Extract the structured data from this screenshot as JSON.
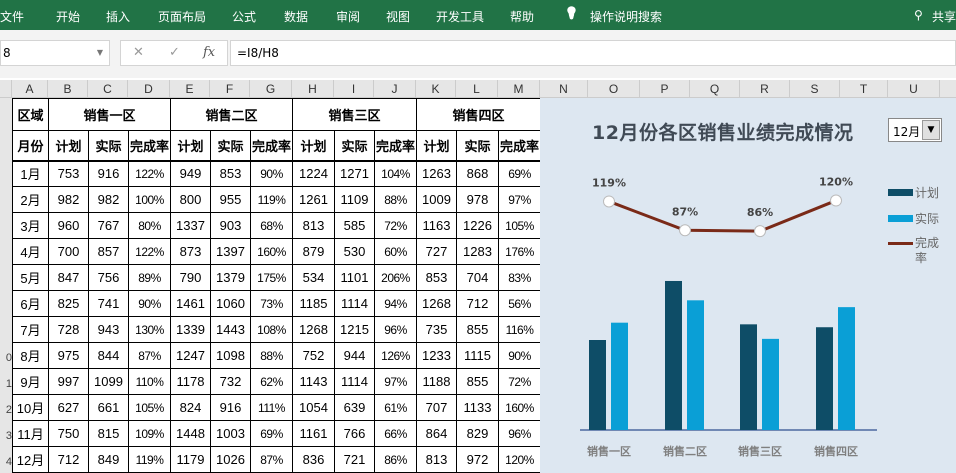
{
  "ribbon": {
    "tabs": [
      "文件",
      "开始",
      "插入",
      "页面布局",
      "公式",
      "数据",
      "审阅",
      "视图",
      "开发工具",
      "帮助"
    ],
    "search": "操作说明搜索",
    "share": "共享"
  },
  "formula_bar": {
    "name_box": "8",
    "cancel": "✕",
    "enter": "✓",
    "fx": "fx",
    "formula": "=I8/H8"
  },
  "columns": [
    "A",
    "B",
    "C",
    "D",
    "E",
    "F",
    "G",
    "H",
    "I",
    "J",
    "K",
    "L",
    "M",
    "N",
    "O",
    "P",
    "Q",
    "R",
    "S",
    "T",
    "U"
  ],
  "row_numbers": [
    "",
    "",
    "",
    "",
    "",
    "",
    "",
    "",
    "",
    "0",
    "1",
    "2",
    "3",
    "4"
  ],
  "table": {
    "region_label": "区域",
    "month_label": "月份",
    "regions": [
      "销售一区",
      "销售二区",
      "销售三区",
      "销售四区"
    ],
    "sub_headers": [
      "计划",
      "实际",
      "完成率"
    ],
    "rows": [
      [
        "1月",
        "753",
        "916",
        "122%",
        "949",
        "853",
        "90%",
        "1224",
        "1271",
        "104%",
        "1263",
        "868",
        "69%"
      ],
      [
        "2月",
        "982",
        "982",
        "100%",
        "800",
        "955",
        "119%",
        "1261",
        "1109",
        "88%",
        "1009",
        "978",
        "97%"
      ],
      [
        "3月",
        "960",
        "767",
        "80%",
        "1337",
        "903",
        "68%",
        "813",
        "585",
        "72%",
        "1163",
        "1226",
        "105%"
      ],
      [
        "4月",
        "700",
        "857",
        "122%",
        "873",
        "1397",
        "160%",
        "879",
        "530",
        "60%",
        "727",
        "1283",
        "176%"
      ],
      [
        "5月",
        "847",
        "756",
        "89%",
        "790",
        "1379",
        "175%",
        "534",
        "1101",
        "206%",
        "853",
        "704",
        "83%"
      ],
      [
        "6月",
        "825",
        "741",
        "90%",
        "1461",
        "1060",
        "73%",
        "1185",
        "1114",
        "94%",
        "1268",
        "712",
        "56%"
      ],
      [
        "7月",
        "728",
        "943",
        "130%",
        "1339",
        "1443",
        "108%",
        "1268",
        "1215",
        "96%",
        "735",
        "855",
        "116%"
      ],
      [
        "8月",
        "975",
        "844",
        "87%",
        "1247",
        "1098",
        "88%",
        "752",
        "944",
        "126%",
        "1233",
        "1115",
        "90%"
      ],
      [
        "9月",
        "997",
        "1099",
        "110%",
        "1178",
        "732",
        "62%",
        "1143",
        "1114",
        "97%",
        "1188",
        "855",
        "72%"
      ],
      [
        "10月",
        "627",
        "661",
        "105%",
        "824",
        "916",
        "111%",
        "1054",
        "639",
        "61%",
        "707",
        "1133",
        "160%"
      ],
      [
        "11月",
        "750",
        "815",
        "109%",
        "1448",
        "1003",
        "69%",
        "1161",
        "766",
        "66%",
        "864",
        "829",
        "96%"
      ],
      [
        "12月",
        "712",
        "849",
        "119%",
        "1179",
        "1026",
        "87%",
        "836",
        "721",
        "86%",
        "813",
        "972",
        "120%"
      ]
    ]
  },
  "chart_data": {
    "type": "bar",
    "title": "12月份各区销售业绩完成情况",
    "selector_value": "12月",
    "categories": [
      "销售一区",
      "销售二区",
      "销售三区",
      "销售四区"
    ],
    "series": [
      {
        "name": "计划",
        "type": "bar",
        "color": "#0e4d67",
        "values": [
          712,
          1179,
          836,
          813
        ]
      },
      {
        "name": "实际",
        "type": "bar",
        "color": "#0a9fd6",
        "values": [
          849,
          1026,
          721,
          972
        ]
      },
      {
        "name": "完成率",
        "type": "line",
        "color": "#7a2a18",
        "values": [
          119,
          87,
          86,
          120
        ],
        "labels": [
          "119%",
          "87%",
          "86%",
          "120%"
        ]
      }
    ],
    "legend": "right"
  }
}
